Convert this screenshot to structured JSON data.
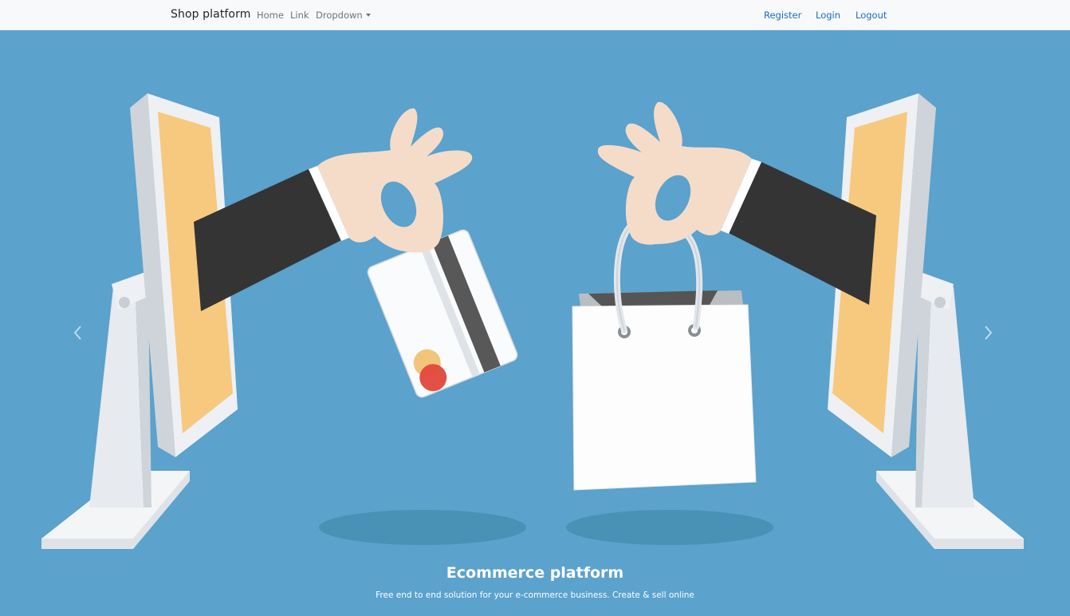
{
  "nav": {
    "brand": "Shop platform",
    "links": [
      "Home",
      "Link",
      "Dropdown"
    ],
    "right_links": [
      "Register",
      "Login",
      "Logout"
    ]
  },
  "hero": {
    "title": "Ecommerce platform",
    "subtitle": "Free end to end solution for your e-commerce business. Create & sell online",
    "prev_icon": "chevron-left",
    "next_icon": "chevron-right"
  },
  "colors": {
    "hero_bg": "#5ba2cd",
    "nav_bg": "#f8f9fa",
    "link_accent": "#1a6cc7",
    "screen": "#f7c97e",
    "sleeve": "#343434",
    "skin": "#f5dcc9"
  }
}
